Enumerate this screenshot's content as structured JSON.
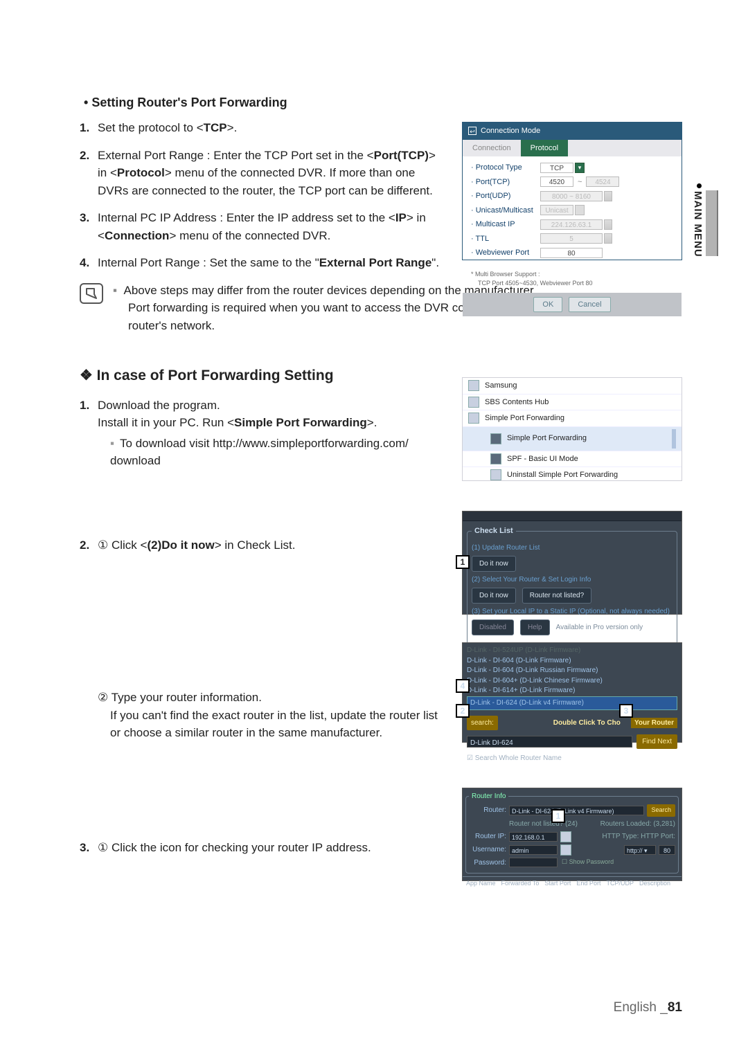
{
  "sideTab": "MAIN MENU",
  "footer": {
    "lang": "English",
    "sep": "_",
    "page": "81"
  },
  "sec1": {
    "heading": "Setting Router's Port Forwarding",
    "step1": {
      "pre": "Set the protocol to <",
      "bold": "TCP",
      "post": ">."
    },
    "step2": {
      "pre": "External Port Range : Enter the TCP Port set in the <",
      "b1": "Port(TCP)",
      "m1": "> in <",
      "b2": "Protocol",
      "post": "> menu of the connected DVR. If more than one DVRs are connected to the router, the TCP port can be different."
    },
    "step3": {
      "pre": "Internal PC IP Address : Enter the IP address set to the <",
      "b1": "IP",
      "m1": "> in <",
      "b2": "Connection",
      "post": "> menu of the connected DVR."
    },
    "step4": {
      "pre": "Internal Port Range : Set the same to the \"",
      "b1": "External Port Range",
      "post": "\"."
    },
    "noteA": "Above steps may differ from the router devices depending on the manufacturer.",
    "noteB": "Port forwarding is required when you want to access the DVR connected to the router from outside of the router's network."
  },
  "sec2": {
    "heading": "In case of Port Forwarding Setting",
    "step1a": "Download the program.",
    "step1b_pre": "Install it in your PC. Run <",
    "step1b_b": "Simple Port Forwarding",
    "step1b_post": ">.",
    "step1c": "To download visit http://www.simpleportforwarding.com/ download",
    "step2_pre": "① Click <",
    "step2_b": "(2)Do it now",
    "step2_post": "> in Check List.",
    "step2sub": "② Type your router information.",
    "step2sub_body": "If you can't find the exact router in the list, update the router list or choose a similar router in the same manufacturer.",
    "step3": "① Click the icon for checking your router IP address."
  },
  "figConn": {
    "title": "Connection Mode",
    "tabConnection": "Connection",
    "tabProtocol": "Protocol",
    "lblProtoType": "· Protocol Type",
    "valProtoType": "TCP",
    "lblPortTcp": "· Port(TCP)",
    "valPortTcp1": "4520",
    "valPortTcp2": "4524",
    "lblPortUdp": "· Port(UDP)",
    "valPortUdp": "8000 ~ 8160",
    "lblUM": "· Unicast/Multicast",
    "valUM": "Unicast",
    "lblMIP": "· Multicast IP",
    "valMIP": "224.126.63.1",
    "lblTTL": "· TTL",
    "valTTL": "5",
    "lblWeb": "· Webviewer Port",
    "valWeb": "80",
    "multi": "* Multi Browser Support :",
    "multiNote": "TCP Port 4505~4530, Webviewer Port 80",
    "ok": "OK",
    "cancel": "Cancel"
  },
  "figStart": {
    "i1": "Samsung",
    "i2": "SBS Contents Hub",
    "i3": "Simple Port Forwarding",
    "s1": "Simple Port Forwarding",
    "s2": "SPF - Basic UI Mode",
    "s3": "Uninstall Simple Port Forwarding"
  },
  "figCheck": {
    "legend": "Check List",
    "h1": "(1) Update Router List",
    "b1": "Do it now",
    "h2": "(2) Select Your Router & Set Login Info",
    "b2a": "Do it now",
    "b2b": "Router not listed?",
    "h3": "(3) Set your Local IP to a Static IP (Optional, not always needed)",
    "b3a": "Disabled",
    "b3b": "Help",
    "n3": "Available in Pro version only"
  },
  "figSearch": {
    "l1": "D-Link - DI-524UP (D-Link Firmware)",
    "l2": "D-Link - DI-604 (D-Link Firmware)",
    "l3": "D-Link - DI-604 (D-Link Russian Firmware)",
    "l4": "D-Link - DI-604+ (D-Link Chinese Firmware)",
    "l5": "D-Link - DI-614+ (D-Link Firmware)",
    "sel": "D-Link - DI-624 (D-Link v4 Firmware)",
    "searchLbl": "search:",
    "dbl": "Double Click To Cho",
    "your": "Your Router",
    "input": "D-Link DI-624",
    "find": "Find Next",
    "chk": "Search Whole Router Name"
  },
  "figInfo": {
    "legend": "Router Info",
    "router": "D-Link - DI-624 (D-Link v4 Firmware)",
    "search": "Search",
    "notlisted": "Router not listed? (24)",
    "loaded": "Routers Loaded: (3,281)",
    "ipLbl": "Router IP:",
    "ip": "192.168.0.1",
    "userLbl": "Username:",
    "user": "admin",
    "passLbl": "Password:",
    "show": "Show Password",
    "httpTypeLbl": "HTTP Type:",
    "httpType": "http:// ▾",
    "httpPortLbl": "HTTP Port:",
    "httpPort": "80",
    "cols": {
      "c1": "App Name",
      "c2": "Forwarded To",
      "c3": "Start Port",
      "c4": "End Port",
      "c5": "TCP/UDP",
      "c6": "Description"
    }
  }
}
